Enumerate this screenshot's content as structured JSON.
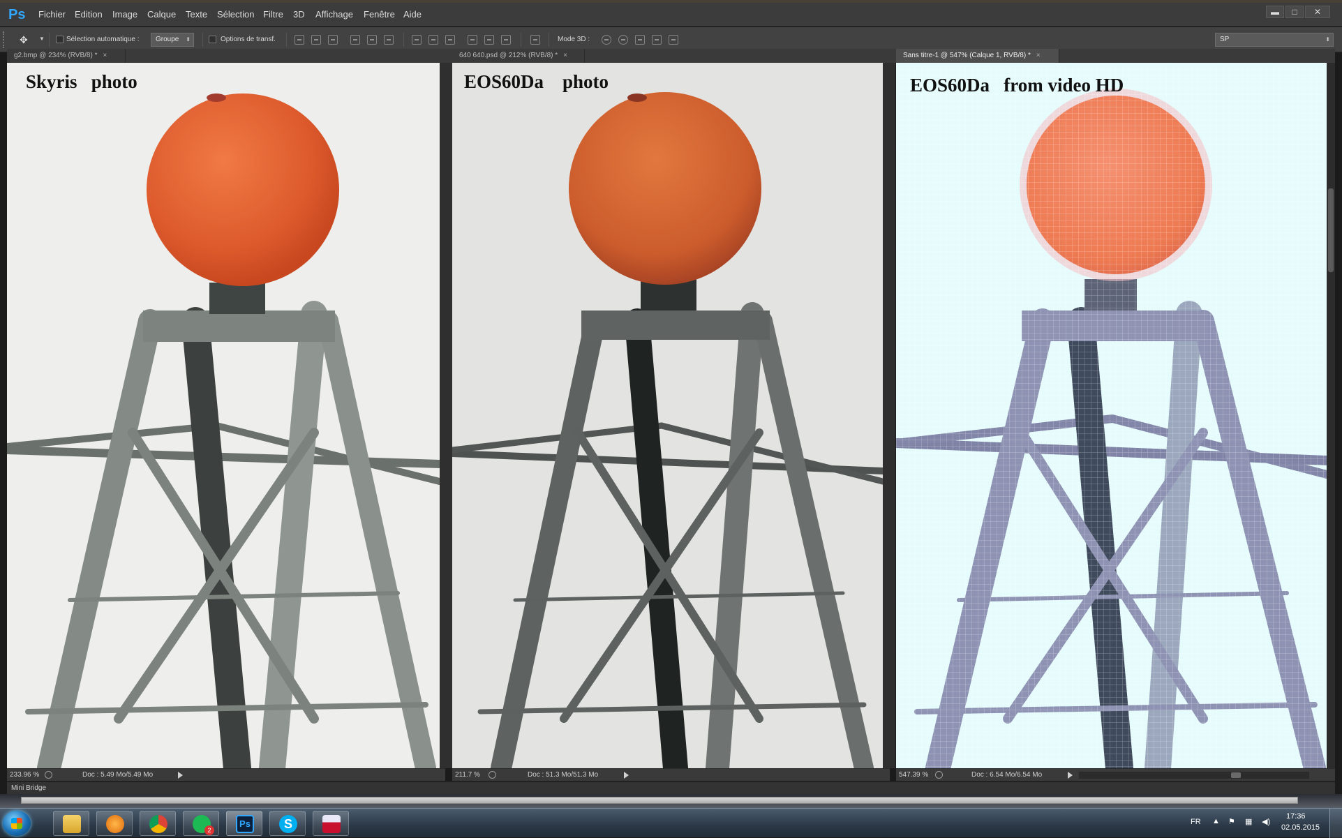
{
  "app": {
    "logo": "Ps"
  },
  "menu": [
    "Fichier",
    "Edition",
    "Image",
    "Calque",
    "Texte",
    "Sélection",
    "Filtre",
    "3D",
    "Affichage",
    "Fenêtre",
    "Aide"
  ],
  "window_controls": {
    "minimize": "▬",
    "maximize": "□",
    "close": "✕"
  },
  "options_bar": {
    "auto_select_label": "Sélection automatique :",
    "auto_select_value": "Groupe",
    "transform_label": "Options de transf.",
    "mode3d_label": "Mode 3D :",
    "workspace_value": "SP"
  },
  "documents": [
    {
      "tab": "g2.bmp @ 234% (RVB/8) *",
      "close": "×",
      "label": "Skyris   photo",
      "zoom": "233.96 %",
      "doc": "Doc : 5.49 Mo/5.49 Mo"
    },
    {
      "tab": "640 640.psd @ 212% (RVB/8) *",
      "close": "×",
      "label": "EOS60Da    photo",
      "zoom": "211.7 %",
      "doc": "Doc : 51.3 Mo/51.3 Mo"
    },
    {
      "tab": "Sans titre-1 @ 547% (Calque 1, RVB/8) *",
      "close": "×",
      "label": "EOS60Da   from video HD",
      "zoom": "547.39 %",
      "doc": "Doc : 6.54 Mo/6.54 Mo"
    }
  ],
  "panels": {
    "mini_bridge": "Mini Bridge"
  },
  "taskbar": {
    "apps": [
      "file-explorer",
      "media-player",
      "chrome",
      "spotify",
      "photoshop",
      "skype",
      "save-app"
    ],
    "badge": "2",
    "language": "FR",
    "time": "17:36",
    "date": "02.05.2015"
  },
  "colors": {
    "ps_blue": "#31a8ff",
    "ui_dark": "#3c3c3c",
    "canvas_bg_1": "#eeeeec",
    "canvas_bg_2": "#e3e4e2",
    "canvas_bg_3": "#e6fbfb"
  }
}
